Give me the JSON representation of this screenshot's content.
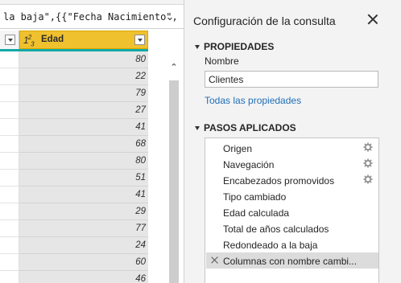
{
  "formula_bar": {
    "text": "la baja\",{{\"Fecha Nacimiento\",",
    "expand_icon": "chevron-down-icon"
  },
  "grid": {
    "column": {
      "type_icon": "1²₃",
      "name": "Edad"
    },
    "values": [
      "80",
      "22",
      "79",
      "27",
      "41",
      "68",
      "80",
      "51",
      "41",
      "29",
      "77",
      "24",
      "60",
      "46"
    ]
  },
  "query_settings": {
    "title": "Configuración de la consulta",
    "properties": {
      "heading": "PROPIEDADES",
      "name_label": "Nombre",
      "name_value": "Clientes",
      "all_properties_link": "Todas las propiedades"
    },
    "applied_steps": {
      "heading": "PASOS APLICADOS",
      "items": [
        {
          "label": "Origen",
          "has_settings": true
        },
        {
          "label": "Navegación",
          "has_settings": true
        },
        {
          "label": "Encabezados promovidos",
          "has_settings": true
        },
        {
          "label": "Tipo cambiado",
          "has_settings": false
        },
        {
          "label": "Edad calculada",
          "has_settings": false
        },
        {
          "label": "Total de años calculados",
          "has_settings": false
        },
        {
          "label": "Redondeado a la baja",
          "has_settings": false
        },
        {
          "label": "Columnas con nombre cambi...",
          "has_settings": false,
          "selected": true
        }
      ]
    }
  },
  "colors": {
    "column_header": "#f0c12e",
    "selected_column_line": "#13a8a8",
    "link": "#1f6fb7",
    "pane_background": "#f3f3f3"
  }
}
